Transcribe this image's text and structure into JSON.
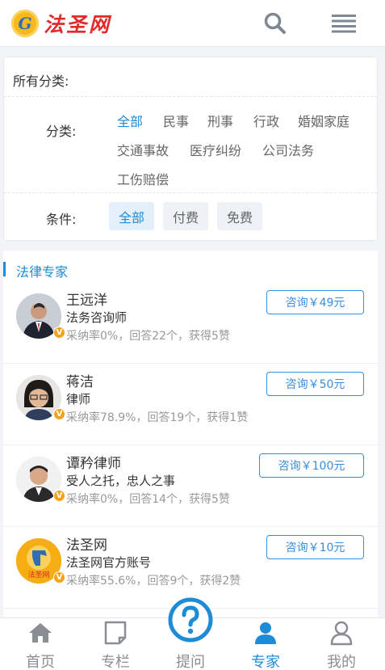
{
  "header": {
    "logo_glyph": "G",
    "site_name": "法圣网",
    "icons": [
      "search-icon",
      "menu-icon"
    ]
  },
  "filter": {
    "all_label": "所有分类:",
    "category_label": "分类:",
    "categories": [
      "全部",
      "民事",
      "刑事",
      "行政",
      "婚姻家庭",
      "交通事故",
      "医疗纠纷",
      "公司法务",
      "工伤赔偿"
    ],
    "selected_category": "全部",
    "condition_label": "条件:",
    "conditions": [
      "全部",
      "付费",
      "免费"
    ],
    "selected_condition": "全部"
  },
  "experts_section": {
    "title": "法律专家",
    "badge_glyph": "V",
    "experts": [
      {
        "name": "王远洋",
        "title": "法务咨询师",
        "stats": "采纳率0%，回答22个，获得5赞",
        "consult": "咨询￥49元"
      },
      {
        "name": "蒋洁",
        "title": "律师",
        "stats": "采纳率78.9%，回答19个，获得1赞",
        "consult": "咨询￥50元"
      },
      {
        "name": "谭矜律师",
        "title": "受人之托，忠人之事",
        "stats": "采纳率0%，回答14个，获得5赞",
        "consult": "咨询￥100元"
      },
      {
        "name": "法圣网",
        "title": "法圣网官方账号",
        "stats": "采纳率55.6%，回答9个，获得2赞",
        "consult": "咨询￥10元",
        "avatar_text": "法圣网"
      }
    ]
  },
  "bottom_nav": {
    "items": [
      {
        "label": "首页",
        "icon": "home-icon"
      },
      {
        "label": "专栏",
        "icon": "column-icon"
      },
      {
        "label": "提问",
        "icon": "question-icon"
      },
      {
        "label": "专家",
        "icon": "expert-icon"
      },
      {
        "label": "我的",
        "icon": "user-icon"
      }
    ],
    "active": "专家"
  },
  "colors": {
    "accent": "#1e8bd6",
    "brand_red": "#e12a2a",
    "badge": "#f4a31e"
  }
}
